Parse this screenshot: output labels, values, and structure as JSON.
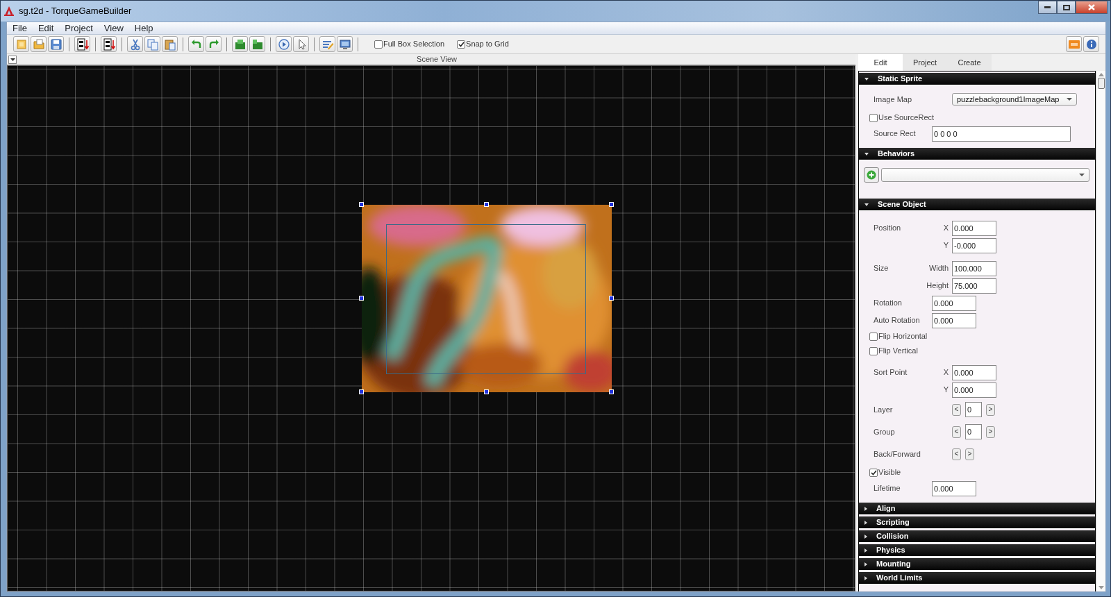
{
  "window": {
    "title": "sg.t2d - TorqueGameBuilder"
  },
  "menu": [
    "File",
    "Edit",
    "Project",
    "View",
    "Help"
  ],
  "toolbar": {
    "options": [
      {
        "label": "Full Box Selection",
        "checked": false
      },
      {
        "label": "Snap to Grid",
        "checked": true
      }
    ]
  },
  "scene_view": {
    "title": "Scene View"
  },
  "panel": {
    "tabs": [
      {
        "label": "Edit",
        "selected": true
      },
      {
        "label": "Project",
        "selected": false
      },
      {
        "label": "Create",
        "selected": false
      }
    ],
    "sections": [
      {
        "title": "Static Sprite",
        "expanded": true,
        "rows": [
          {
            "kind": "dropdown",
            "label": "Image Map",
            "value": "puzzlebackground1ImageMap"
          },
          {
            "kind": "checkbox",
            "label": "Use SourceRect",
            "checked": false
          },
          {
            "kind": "text",
            "label": "Source Rect",
            "value": "0 0 0 0"
          }
        ]
      },
      {
        "title": "Behaviors",
        "expanded": true,
        "rows": [
          {
            "kind": "behavior"
          }
        ]
      },
      {
        "title": "Scene Object",
        "expanded": true,
        "rows": [
          {
            "kind": "number",
            "label": "Position",
            "sublabel": "X",
            "value": "0.000"
          },
          {
            "kind": "number",
            "sublabel": "Y",
            "value": "-0.000"
          },
          {
            "kind": "number",
            "label": "Size",
            "sublabel": "Width",
            "value": "100.000"
          },
          {
            "kind": "number",
            "sublabel": "Height",
            "value": "75.000"
          },
          {
            "kind": "number",
            "label": "Rotation",
            "value": "0.000"
          },
          {
            "kind": "number",
            "label": "Auto Rotation",
            "value": "0.000"
          },
          {
            "kind": "checkbox",
            "label": "Flip Horizontal",
            "checked": false
          },
          {
            "kind": "checkbox",
            "label": "Flip Vertical",
            "checked": false
          },
          {
            "kind": "number",
            "label": "Sort Point",
            "sublabel": "X",
            "value": "0.000"
          },
          {
            "kind": "number",
            "sublabel": "Y",
            "value": "0.000"
          },
          {
            "kind": "stepper",
            "label": "Layer",
            "prev": "<",
            "value": "0",
            "next": ">"
          },
          {
            "kind": "stepper",
            "label": "Group",
            "prev": "<",
            "value": "0",
            "next": ">"
          },
          {
            "kind": "stepper",
            "label": "Back/Forward",
            "prev": "<",
            "next": ">"
          },
          {
            "kind": "checkbox",
            "label": "Visible",
            "checked": true
          },
          {
            "kind": "number",
            "label": "Lifetime",
            "value": "0.000"
          }
        ]
      },
      {
        "title": "Align",
        "expanded": false
      },
      {
        "title": "Scripting",
        "expanded": false
      },
      {
        "title": "Collision",
        "expanded": false
      },
      {
        "title": "Physics",
        "expanded": false
      },
      {
        "title": "Mounting",
        "expanded": false
      },
      {
        "title": "World Limits",
        "expanded": false
      }
    ]
  }
}
